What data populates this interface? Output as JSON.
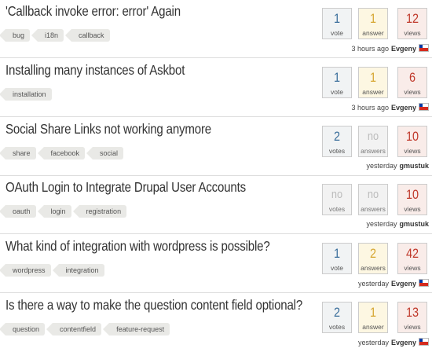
{
  "questions": [
    {
      "title": "'Callback invoke error: error' Again",
      "tags": [
        "bug",
        "i18n",
        "callback"
      ],
      "votes": {
        "count": "1",
        "label": "vote"
      },
      "answers": {
        "count": "1",
        "label": "answer"
      },
      "views": {
        "count": "12",
        "label": "views"
      },
      "time": "3 hours ago",
      "user": "Evgeny",
      "flag_icon": "chile-flag-icon"
    },
    {
      "title": "Installing many instances of Askbot",
      "tags": [
        "installation"
      ],
      "votes": {
        "count": "1",
        "label": "vote"
      },
      "answers": {
        "count": "1",
        "label": "answer"
      },
      "views": {
        "count": "6",
        "label": "views"
      },
      "time": "3 hours ago",
      "user": "Evgeny",
      "flag_icon": "chile-flag-icon"
    },
    {
      "title": "Social Share Links not working anymore",
      "tags": [
        "share",
        "facebook",
        "social"
      ],
      "votes": {
        "count": "2",
        "label": "votes"
      },
      "answers": {
        "count": "no",
        "label": "answers"
      },
      "views": {
        "count": "10",
        "label": "views"
      },
      "time": "yesterday",
      "user": "gmustuk",
      "flag_icon": ""
    },
    {
      "title": "OAuth Login to Integrate Drupal User Accounts",
      "tags": [
        "oauth",
        "login",
        "registration"
      ],
      "votes": {
        "count": "no",
        "label": "votes"
      },
      "answers": {
        "count": "no",
        "label": "answers"
      },
      "views": {
        "count": "10",
        "label": "views"
      },
      "time": "yesterday",
      "user": "gmustuk",
      "flag_icon": ""
    },
    {
      "title": "What kind of integration with wordpress is possible?",
      "tags": [
        "wordpress",
        "integration"
      ],
      "votes": {
        "count": "1",
        "label": "vote"
      },
      "answers": {
        "count": "2",
        "label": "answers"
      },
      "views": {
        "count": "42",
        "label": "views"
      },
      "time": "yesterday",
      "user": "Evgeny",
      "flag_icon": "chile-flag-icon"
    },
    {
      "title": "Is there a way to make the question content field optional?",
      "tags": [
        "question",
        "contentfield",
        "feature-request"
      ],
      "votes": {
        "count": "2",
        "label": "votes"
      },
      "answers": {
        "count": "1",
        "label": "answer"
      },
      "views": {
        "count": "13",
        "label": "views"
      },
      "time": "yesterday",
      "user": "Evgeny",
      "flag_icon": "chile-flag-icon"
    }
  ],
  "colors": {
    "votes": "#3a6e9b",
    "answers": "#d6a630",
    "views": "#c0392b",
    "title": "#333333",
    "tag_bg": "#e9e9e6"
  }
}
